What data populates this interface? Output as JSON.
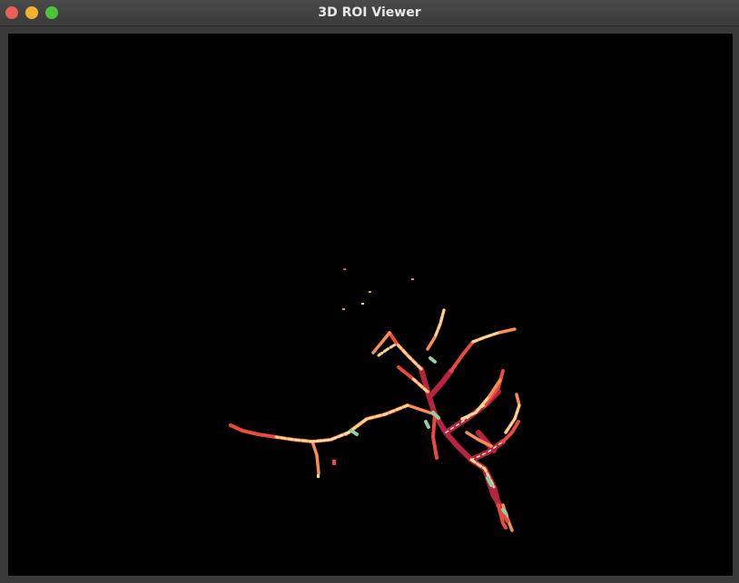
{
  "window": {
    "title": "3D ROI Viewer",
    "controls": {
      "close_color": "#ec5f56",
      "minimize_color": "#f4b12f",
      "maximize_color": "#4bc33b"
    }
  },
  "viewport": {
    "background": "#000000",
    "render_palette": [
      "#b8243f",
      "#e84a3c",
      "#f78e58",
      "#fdd38f",
      "#fff2c4",
      "#8fcfa8"
    ]
  }
}
